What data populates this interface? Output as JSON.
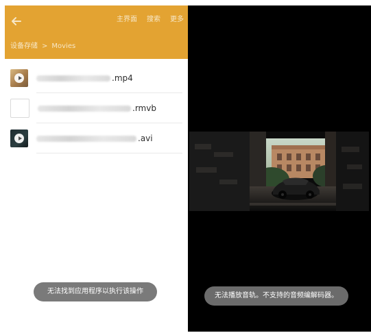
{
  "left_panel": {
    "app_bar": {
      "back_icon": "arrow-left-icon",
      "actions": {
        "home": "主界面",
        "search": "搜索",
        "more": "更多"
      },
      "breadcrumb": {
        "root": "设备存储",
        "separator": ">",
        "current": "Movies"
      },
      "colors": {
        "bar": "#e3a332",
        "text": "#f7e7c7"
      }
    },
    "files": [
      {
        "extension": ".mp4",
        "thumbnail": "video-thumbnail"
      },
      {
        "extension": ".rmvb",
        "thumbnail": "blank-file-thumbnail"
      },
      {
        "extension": ".avi",
        "thumbnail": "video-thumbnail"
      }
    ],
    "toast": "无法找到应用程序以执行该操作"
  },
  "right_panel": {
    "toast": "无法播放音轨。不支持的音频编解码器。",
    "colors": {
      "background": "#000000",
      "toast_bg": "#6b6b6b"
    }
  }
}
